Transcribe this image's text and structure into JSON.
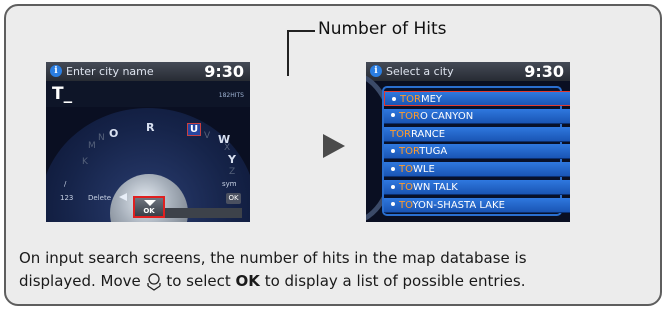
{
  "callout": {
    "label": "Number of Hits"
  },
  "left_screen": {
    "title": "Enter city name",
    "clock": "9:30",
    "entry_text": "T_",
    "hits": "182HITS",
    "letters_dim": [
      "K",
      "M",
      "N",
      "V",
      "W",
      "X",
      "Y",
      "Z"
    ],
    "letters_bright": [
      "O",
      "R"
    ],
    "letter_selected": "U",
    "slash": "/",
    "numeric_key": "123",
    "delete_label": "Delete",
    "symbol_key": "sym",
    "ok_key": "OK",
    "ok_center": "OK"
  },
  "right_screen": {
    "title": "Select a city",
    "clock": "9:30",
    "cities": [
      {
        "hl": "TOR",
        "rest": "MEY",
        "bullet": true
      },
      {
        "hl": "TOR",
        "rest": "O CANYON",
        "bullet": true
      },
      {
        "hl": "TOR",
        "rest": "RANCE",
        "bullet": false
      },
      {
        "hl": "TOR",
        "rest": "TUGA",
        "bullet": true
      },
      {
        "hl": "TO",
        "rest": "WLE",
        "bullet": true
      },
      {
        "hl": "TO",
        "rest": "WN TALK",
        "bullet": true
      },
      {
        "hl": "TO",
        "rest": "YON-SHASTA LAKE",
        "bullet": true
      }
    ]
  },
  "caption": {
    "line1": "On input search screens, the number of hits in the map database is",
    "line2_a": "displayed. Move",
    "line2_b": "to select",
    "line2_ok": "OK",
    "line2_c": "to display a list of possible entries."
  },
  "colors": {
    "list_row": "#2f78df",
    "highlight": "#ff9a2a",
    "selection_border": "#e03a30",
    "panel_bg": "#ececec"
  }
}
